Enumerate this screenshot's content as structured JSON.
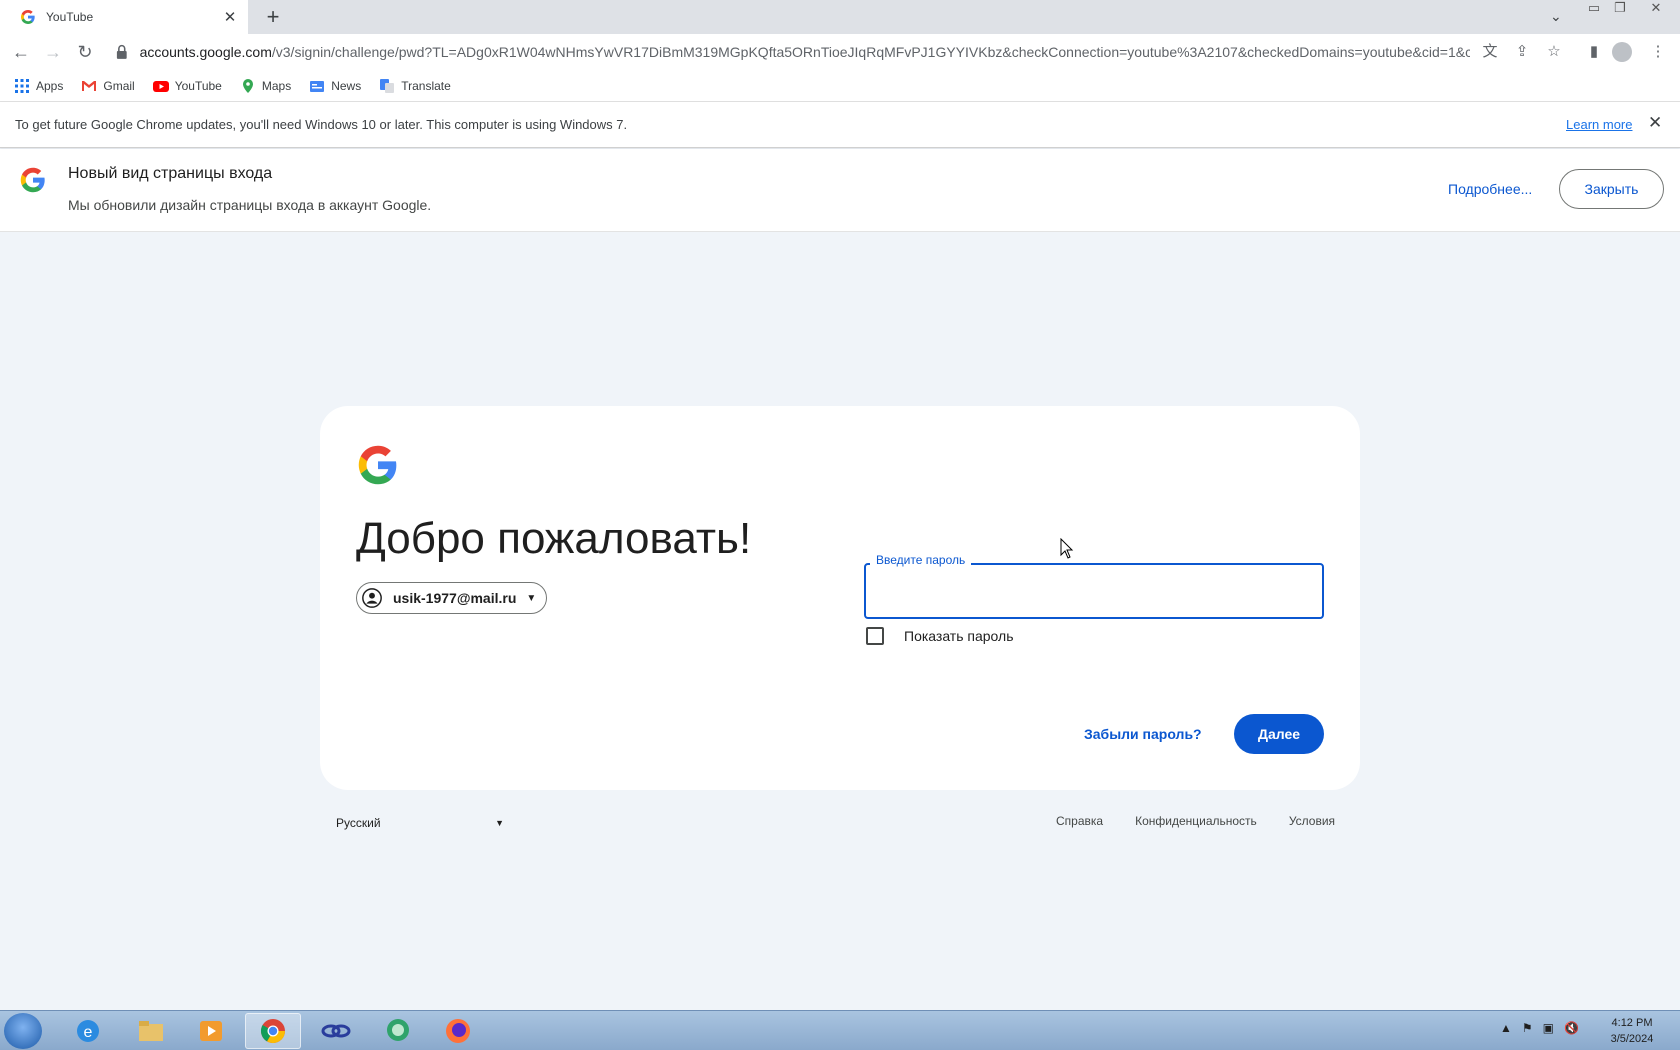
{
  "browser": {
    "tab_title": "YouTube",
    "url_host": "accounts.google.com",
    "url_path": "/v3/signin/challenge/pwd?TL=ADg0xR1W04wNHmsYwVR17DiBmM319MGpKQfta5ORnTioeJIqRqMFvPJ1GYYIVKbz&checkConnection=youtube%3A2107&checkedDomains=youtube&cid=1&c..."
  },
  "bookmarks": [
    {
      "label": "Apps",
      "icon": "apps-grid-icon"
    },
    {
      "label": "Gmail",
      "icon": "gmail-icon"
    },
    {
      "label": "YouTube",
      "icon": "youtube-icon"
    },
    {
      "label": "Maps",
      "icon": "maps-icon"
    },
    {
      "label": "News",
      "icon": "news-icon"
    },
    {
      "label": "Translate",
      "icon": "translate-icon"
    }
  ],
  "update_bar": {
    "message": "To get future Google Chrome updates, you'll need Windows 10 or later. This computer is using Windows 7.",
    "learn_more": "Learn more"
  },
  "banner": {
    "title": "Новый вид страницы входа",
    "subtitle": "Мы обновили дизайн страницы входа в аккаунт Google.",
    "more_link": "Подробнее...",
    "close_button": "Закрыть"
  },
  "signin": {
    "heading": "Добро пожаловать!",
    "account_email": "usik-1977@mail.ru",
    "password_label": "Введите пароль",
    "password_value": "",
    "show_password": "Показать пароль",
    "show_password_checked": false,
    "forgot_link": "Забыли пароль?",
    "next_button": "Далее"
  },
  "footer": {
    "language": "Русский",
    "links": [
      "Справка",
      "Конфиденциальность",
      "Условия"
    ]
  },
  "taskbar": {
    "time": "4:12 PM",
    "date": "3/5/2024"
  },
  "colors": {
    "accent": "#0b57d0",
    "page_bg": "#f0f4f9"
  }
}
